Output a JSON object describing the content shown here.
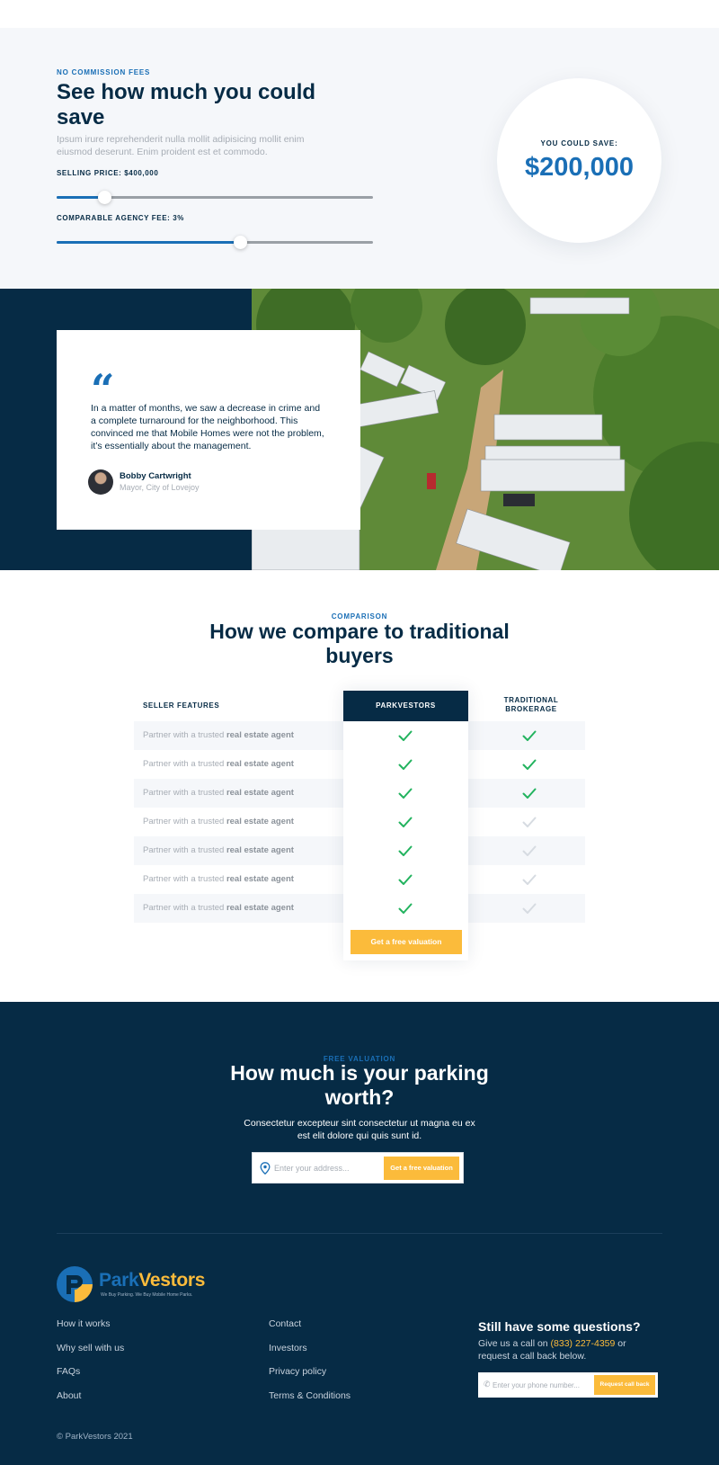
{
  "savings": {
    "eyebrow": "NO COMMISSION FEES",
    "title": "See how much you could save",
    "lead": "Ipsum irure reprehenderit nulla mollit adipisicing mollit enim eiusmod deserunt. Enim proident est et commodo.",
    "selling_price_label": "SELLING PRICE: $400,000",
    "selling_price_fraction": 0.15,
    "agency_fee_label": "COMPARABLE AGENCY FEE: 3%",
    "agency_fee_fraction": 0.58,
    "result_label": "YOU COULD SAVE:",
    "result_amount": "$200,000"
  },
  "testimonial": {
    "quote_mark": "“",
    "quote": "In a matter of months, we saw a decrease in crime and a complete turnaround for the neighborhood. This convinced me that Mobile Homes were not the problem, it’s essentially about the management.",
    "name": "Bobby Cartwright",
    "role": "Mayor, City of Lovejoy"
  },
  "comparison": {
    "eyebrow": "COMPARISON",
    "title": "How we compare to traditional buyers",
    "col_features": "SELLER FEATURES",
    "col_parkvestors": "PARKVESTORS",
    "col_traditional": "TRADITIONAL BROKERAGE",
    "rows": [
      {
        "prefix": "Partner with a trusted ",
        "bold": "real estate agent",
        "parkvestors": true,
        "traditional": true
      },
      {
        "prefix": "Partner with a trusted ",
        "bold": "real estate agent",
        "parkvestors": true,
        "traditional": true
      },
      {
        "prefix": "Partner with a trusted ",
        "bold": "real estate agent",
        "parkvestors": true,
        "traditional": true
      },
      {
        "prefix": "Partner with a trusted ",
        "bold": "real estate agent",
        "parkvestors": true,
        "traditional": false
      },
      {
        "prefix": "Partner with a trusted ",
        "bold": "real estate agent",
        "parkvestors": true,
        "traditional": false
      },
      {
        "prefix": "Partner with a trusted ",
        "bold": "real estate agent",
        "parkvestors": true,
        "traditional": false
      },
      {
        "prefix": "Partner with a trusted ",
        "bold": "real estate agent",
        "parkvestors": true,
        "traditional": false
      }
    ],
    "cta": "Get a free valuation"
  },
  "valuation": {
    "eyebrow": "FREE VALUATION",
    "title": "How much is your parking worth?",
    "subtitle": "Consectetur excepteur sint consectetur ut magna eu ex est elit dolore qui quis sunt id.",
    "address_placeholder": "Enter your address...",
    "cta": "Get a free valuation"
  },
  "footer": {
    "logo_park": "Park",
    "logo_vestors": "Vestors",
    "logo_tagline": "We Buy Parking. We Buy Mobile Home Parks.",
    "links_col1": [
      "How it works",
      "Why sell with us",
      "FAQs",
      "About"
    ],
    "links_col2": [
      "Contact",
      "Investors",
      "Privacy policy",
      "Terms & Conditions"
    ],
    "questions_title": "Still have some questions?",
    "questions_text_before": "Give us a call on ",
    "questions_phone": "(833) 227-4359",
    "questions_text_after": " or request a call back below.",
    "phone_placeholder": "Enter your phone number...",
    "phone_cta": "Request call back",
    "copyright": "© ParkVestors 2021"
  },
  "colors": {
    "navy": "#062b45",
    "brand_blue": "#1a6fb6",
    "accent_yellow": "#fbbb3b",
    "check_green": "#22b35e",
    "check_grey": "#d6dbe1"
  }
}
